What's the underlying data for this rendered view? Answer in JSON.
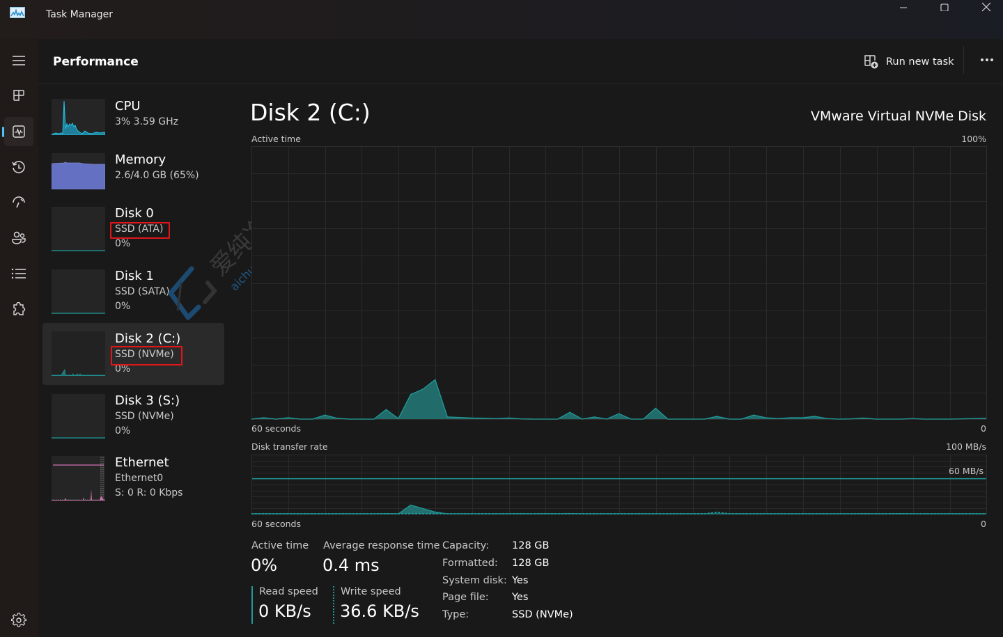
{
  "window": {
    "title": "Task Manager",
    "controls": {
      "minimize": "minimize-icon",
      "maximize": "maximize-icon",
      "close": "close-icon"
    }
  },
  "nav": {
    "items": [
      {
        "name": "hamburger-menu",
        "icon": "hamburger-icon"
      },
      {
        "name": "processes",
        "icon": "processes-icon"
      },
      {
        "name": "performance",
        "icon": "performance-icon",
        "active": true
      },
      {
        "name": "app-history",
        "icon": "history-icon"
      },
      {
        "name": "startup-apps",
        "icon": "startup-icon"
      },
      {
        "name": "users",
        "icon": "users-icon"
      },
      {
        "name": "details",
        "icon": "list-icon"
      },
      {
        "name": "services",
        "icon": "puzzle-icon"
      }
    ],
    "settings_icon": "gear-icon",
    "accent": "#4cc2ff"
  },
  "header": {
    "title": "Performance",
    "run_new_task": "Run new task",
    "more_icon": "more-icon"
  },
  "devices": [
    {
      "name": "CPU",
      "sub1": "3%  3.59 GHz",
      "sub2": ""
    },
    {
      "name": "Memory",
      "sub1": "2.6/4.0 GB (65%)",
      "sub2": ""
    },
    {
      "name": "Disk 0",
      "sub1": "SSD (ATA)",
      "sub2": "0%"
    },
    {
      "name": "Disk 1",
      "sub1": "SSD (SATA)",
      "sub2": "0%"
    },
    {
      "name": "Disk 2 (C:)",
      "sub1": "SSD (NVMe)",
      "sub2": "0%",
      "selected": true
    },
    {
      "name": "Disk 3 (S:)",
      "sub1": "SSD (NVMe)",
      "sub2": "0%"
    },
    {
      "name": "Ethernet",
      "sub1": "Ethernet0",
      "sub2": "S: 0 R: 0 Kbps"
    }
  ],
  "detail": {
    "title": "Disk 2 (C:)",
    "model": "VMware Virtual NVMe Disk",
    "active_chart": {
      "label": "Active time",
      "max_label": "100%",
      "time_label": "60 seconds",
      "min_label": "0"
    },
    "transfer_chart": {
      "label": "Disk transfer rate",
      "max_label": "100 MB/s",
      "line_label": "60 MB/s",
      "time_label": "60 seconds",
      "min_label": "0"
    },
    "stats": {
      "active_time_label": "Active time",
      "active_time_value": "0%",
      "avg_response_label": "Average response time",
      "avg_response_value": "0.4 ms",
      "read_speed_label": "Read speed",
      "read_speed_value": "0 KB/s",
      "write_speed_label": "Write speed",
      "write_speed_value": "36.6 KB/s"
    },
    "properties": [
      {
        "label": "Capacity:",
        "value": "128 GB"
      },
      {
        "label": "Formatted:",
        "value": "128 GB"
      },
      {
        "label": "System disk:",
        "value": "Yes"
      },
      {
        "label": "Page file:",
        "value": "Yes"
      },
      {
        "label": "Type:",
        "value": "SSD (NVMe)"
      }
    ]
  },
  "watermark": {
    "text_cn": "爱纯净",
    "text_url": "aichunjing.com"
  },
  "colors": {
    "disk": "#1f9a9a",
    "disk_fill": "#237070",
    "cpu": "#20b0d0",
    "memory": "#6b74c9",
    "ethernet": "#d070b0",
    "highlight_box": "#e0161a"
  },
  "chart_data": [
    {
      "type": "area",
      "title": "Active time",
      "xlabel": "60 seconds",
      "ylabel": "%",
      "ylim": [
        0,
        100
      ],
      "x_range_seconds": [
        60,
        0
      ],
      "values": [
        0,
        0.5,
        0,
        0.5,
        0,
        0,
        1.5,
        0.3,
        0,
        0,
        0,
        3.5,
        0.2,
        9,
        11,
        14.5,
        0.8,
        0.6,
        0.4,
        0.3,
        0.2,
        0.4,
        0.1,
        0,
        0,
        0,
        2.5,
        0,
        0.8,
        0,
        2,
        0,
        0,
        4,
        0,
        0,
        0,
        0,
        1,
        0,
        0,
        1.5,
        0.5,
        0.2,
        0.5,
        0.5,
        1,
        0.2,
        0,
        0.1,
        0.4,
        0,
        0,
        0,
        0.2,
        0,
        0,
        0,
        0.1,
        0.2,
        0.3
      ]
    },
    {
      "type": "area",
      "title": "Disk transfer rate",
      "xlabel": "60 seconds",
      "ylabel": "MB/s",
      "ylim": [
        0,
        100
      ],
      "reference_line": 60,
      "series": [
        {
          "name": "Read speed",
          "values": [
            0,
            0,
            0,
            0,
            0,
            0,
            0,
            0,
            0,
            0,
            0,
            0.3,
            0,
            15,
            9,
            3,
            0,
            0,
            0,
            0,
            0,
            0,
            0.3,
            0,
            0.3,
            0,
            0.5,
            0,
            0,
            0,
            0,
            0,
            0,
            0,
            0,
            0,
            0,
            0,
            0,
            0,
            0,
            0,
            0,
            0,
            0,
            0,
            0,
            0,
            0,
            0,
            0.3,
            0,
            0,
            0.3,
            0,
            0,
            0,
            0,
            0,
            0,
            0
          ]
        },
        {
          "name": "Write speed",
          "values": [
            0,
            0,
            0,
            0,
            0,
            0,
            0,
            0,
            0,
            0,
            0,
            0,
            0,
            0,
            0,
            0,
            0,
            0,
            0,
            0,
            0,
            0,
            0,
            0,
            0,
            0,
            0,
            0,
            0,
            0,
            0,
            0,
            0,
            0,
            0,
            0,
            0,
            0,
            2.5,
            0,
            0,
            0,
            0,
            0,
            0,
            0,
            0,
            0,
            0,
            0,
            0,
            0,
            0,
            0,
            0,
            0,
            0,
            0,
            0,
            0,
            0
          ]
        }
      ]
    }
  ]
}
